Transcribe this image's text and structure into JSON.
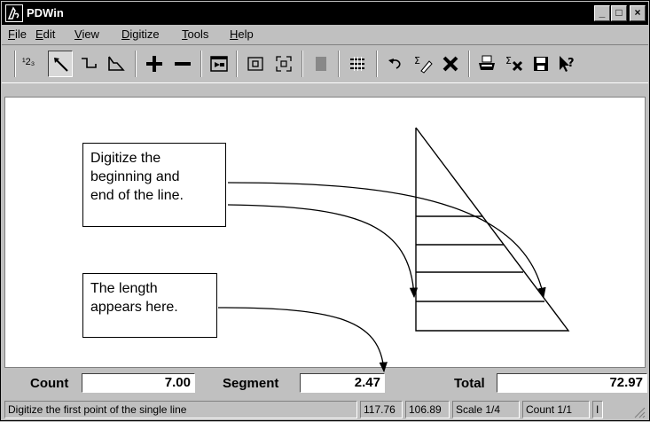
{
  "window": {
    "title": "PDWin"
  },
  "menu": [
    {
      "label": "File",
      "key": "F",
      "rest": "ile"
    },
    {
      "label": "Edit",
      "key": "E",
      "rest": "dit"
    },
    {
      "label": "View",
      "key": "V",
      "rest": "iew"
    },
    {
      "label": "Digitize",
      "key": "D",
      "rest": "igitize"
    },
    {
      "label": "Tools",
      "key": "T",
      "rest": "ools"
    },
    {
      "label": "Help",
      "key": "H",
      "rest": "elp"
    }
  ],
  "toolbar": {
    "count_button_text": "¹2₃"
  },
  "callouts": {
    "digitize": [
      "Digitize the",
      "beginning and",
      "end of the line."
    ],
    "length": [
      "The length",
      "appears here."
    ]
  },
  "databar": {
    "count_label": "Count",
    "count_value": "7.00",
    "segment_label": "Segment",
    "segment_value": "2.47",
    "total_label": "Total",
    "total_value": "72.97"
  },
  "status": {
    "message": "Digitize the first point of the single line",
    "x": "117.76",
    "y": "106.89",
    "scale": "Scale  1/4",
    "count": "Count  1/1",
    "extra": "I"
  }
}
